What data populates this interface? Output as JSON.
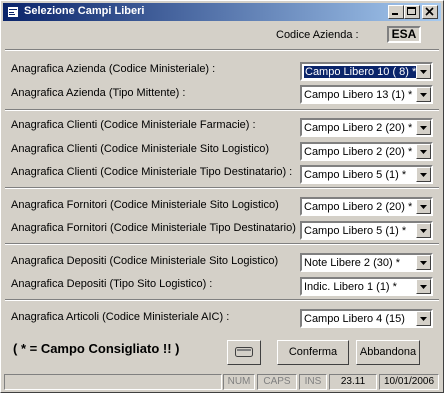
{
  "window": {
    "title": "Selezione Campi Liberi",
    "buttons": {
      "minimize": "minimize-icon",
      "maximize": "maximize-icon",
      "close": "close-icon"
    }
  },
  "header": {
    "codice_azienda_label": "Codice Azienda :",
    "codice_azienda_value": "ESA"
  },
  "fields": [
    {
      "label": "Anagrafica Azienda (Codice Ministeriale) :",
      "value": "Campo Libero 10 ( 8) *",
      "selected": true
    },
    {
      "label": "Anagrafica Azienda (Tipo Mittente) :",
      "value": "Campo Libero 13 (1) *"
    },
    {
      "label": "Anagrafica Clienti (Codice Ministeriale Farmacie) :",
      "value": "Campo Libero  2 (20) *"
    },
    {
      "label": "Anagrafica Clienti (Codice Ministeriale Sito Logistico)",
      "value": "Campo Libero  2 (20) *"
    },
    {
      "label": "Anagrafica Clienti (Codice Ministeriale Tipo Destinatario) :",
      "value": "Campo Libero  5 (1) *"
    },
    {
      "label": "Anagrafica Fornitori (Codice Ministeriale Sito Logistico)",
      "value": "Campo Libero  2 (20) *"
    },
    {
      "label": "Anagrafica Fornitori (Codice Ministeriale Tipo Destinatario) :",
      "value": "Campo Libero  5 (1) *"
    },
    {
      "label": "Anagrafica Depositi (Codice Ministeriale Sito Logistico)",
      "value": "Note Libere  2 (30) *"
    },
    {
      "label": "Anagrafica Depositi (Tipo Sito Logistico) :",
      "value": "Indic. Libero  1 (1) *"
    },
    {
      "label": "Anagrafica Articoli (Codice Ministeriale AIC) :",
      "value": "Campo Libero  4 (15)"
    }
  ],
  "footer": {
    "legend": "( * = Campo Consigliato !! )",
    "conferma": "Conferma",
    "abbandona": "Abbandona"
  },
  "statusbar": {
    "num": "NUM",
    "caps": "CAPS",
    "ins": "INS",
    "time": "23.11",
    "date": "10/01/2006"
  }
}
